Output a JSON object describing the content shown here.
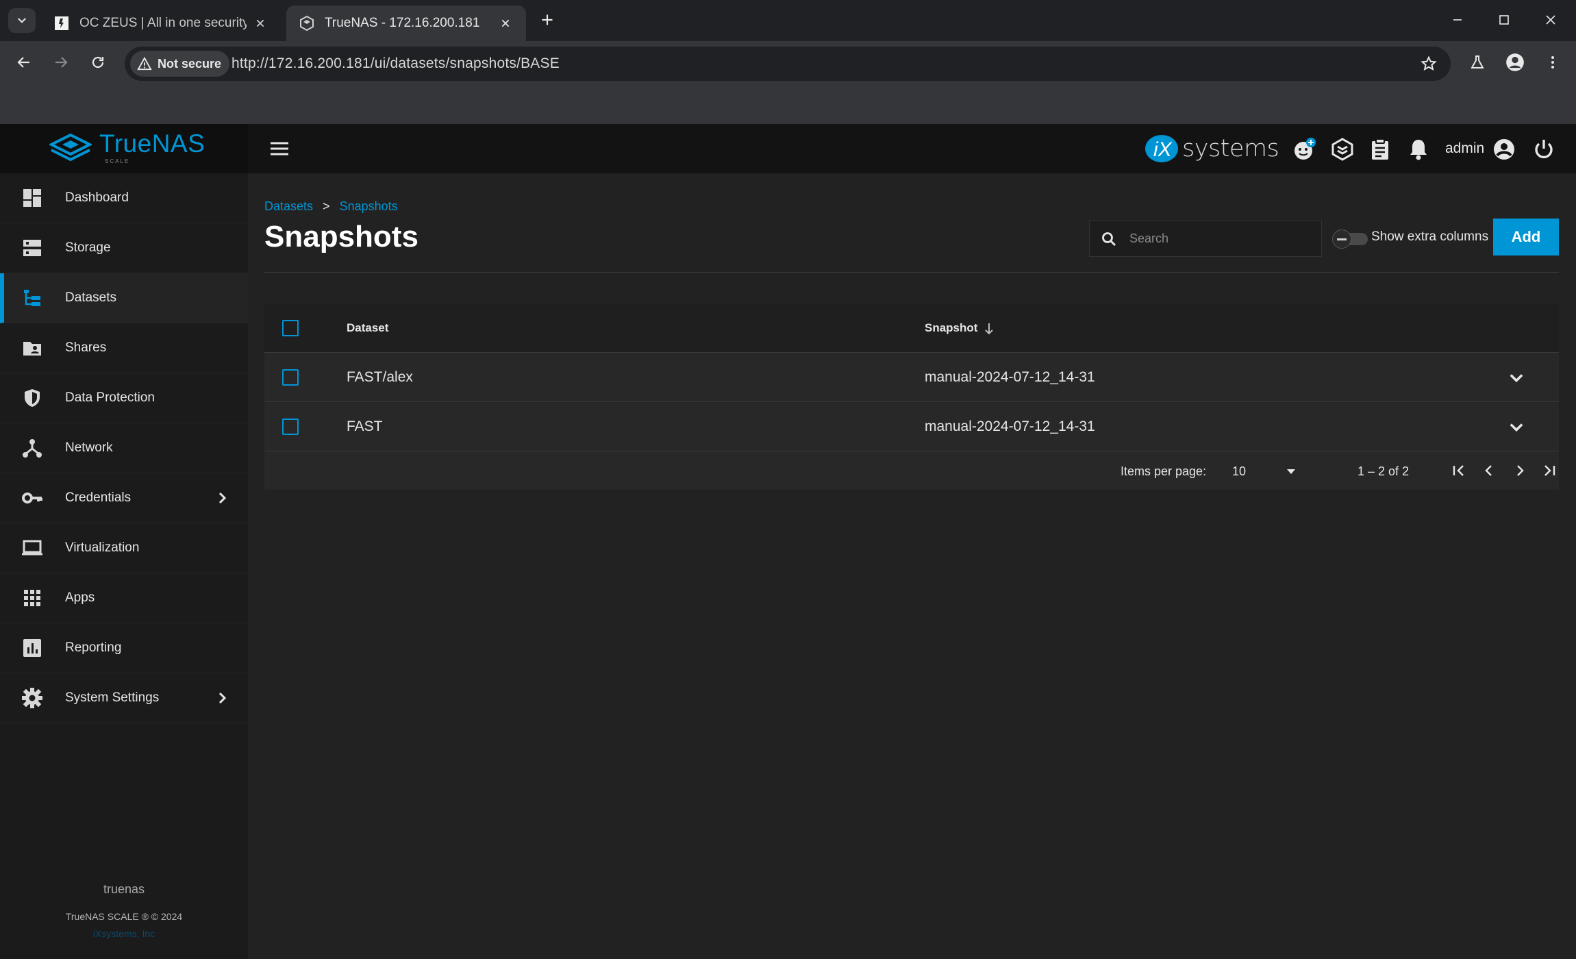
{
  "browser": {
    "tabs": [
      {
        "title": "OC ZEUS | All in one security sc",
        "favicon": "zeus-favicon"
      },
      {
        "title": "TrueNAS - 172.16.200.181",
        "favicon": "truenas-favicon"
      }
    ],
    "security_label": "Not secure",
    "url": "http://172.16.200.181/ui/datasets/snapshots/BASE"
  },
  "header": {
    "brand": "TrueNAS",
    "brand_sub": "SCALE",
    "vendor_logo_ix": "iX",
    "vendor_logo_text": "systems",
    "user": "admin",
    "icons": [
      "feedback-icon",
      "truecommand-icon",
      "jobs-icon",
      "notifications-icon",
      "account-icon",
      "power-icon"
    ]
  },
  "sidebar": {
    "items": [
      {
        "label": "Dashboard",
        "icon": "dashboard-icon"
      },
      {
        "label": "Storage",
        "icon": "storage-icon"
      },
      {
        "label": "Datasets",
        "icon": "datasets-icon",
        "active": true
      },
      {
        "label": "Shares",
        "icon": "shares-icon"
      },
      {
        "label": "Data Protection",
        "icon": "shield-icon"
      },
      {
        "label": "Network",
        "icon": "network-icon"
      },
      {
        "label": "Credentials",
        "icon": "key-icon",
        "has_submenu": true
      },
      {
        "label": "Virtualization",
        "icon": "laptop-icon"
      },
      {
        "label": "Apps",
        "icon": "apps-grid-icon"
      },
      {
        "label": "Reporting",
        "icon": "reporting-icon"
      },
      {
        "label": "System Settings",
        "icon": "gear-icon",
        "has_submenu": true
      }
    ],
    "hostname": "truenas",
    "copyright": "TrueNAS SCALE ® © 2024",
    "company_link": "iXsystems, Inc"
  },
  "main": {
    "breadcrumb": [
      "Datasets",
      "Snapshots"
    ],
    "breadcrumb_sep": ">",
    "title": "Snapshots",
    "search_placeholder": "Search",
    "toggle_label": "Show extra columns",
    "add_label": "Add",
    "table": {
      "columns": [
        "Dataset",
        "Snapshot"
      ],
      "rows": [
        {
          "dataset": "FAST/alex",
          "snapshot": "manual-2024-07-12_14-31"
        },
        {
          "dataset": "FAST",
          "snapshot": "manual-2024-07-12_14-31"
        }
      ],
      "items_per_page_label": "Items per page:",
      "items_per_page": "10",
      "range": "1 – 2 of 2"
    }
  },
  "colors": {
    "accent": "#0095d5",
    "header_bg": "#131313",
    "sidebar_bg": "#1b1b1b",
    "content_bg": "#222222"
  }
}
